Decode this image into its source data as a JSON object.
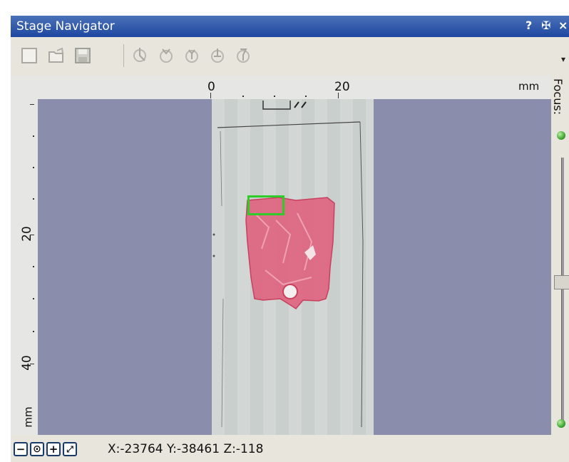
{
  "window": {
    "title": "Stage Navigator",
    "help_glyph": "?",
    "pin_glyph": "✠",
    "close_glyph": "×"
  },
  "toolbar": {
    "icons": [
      "new-icon",
      "open-icon",
      "save-icon",
      "tool-1-icon",
      "tool-2-icon",
      "tool-3-icon",
      "tool-4-icon",
      "tool-5-icon"
    ],
    "overflow_glyph": "▾"
  },
  "rulers": {
    "top_labels": [
      "0",
      "20",
      "mm"
    ],
    "left_labels": [
      "20",
      "40",
      "mm"
    ]
  },
  "focus": {
    "label": "Focus:",
    "level": 0.47
  },
  "status": {
    "coords": "X:-23764 Y:-38461 Z:-118",
    "buttons": [
      "−",
      "⊙",
      "+",
      "⤢"
    ]
  },
  "colors": {
    "title_bar": "#2a53a8",
    "viewport_bg": "#8b8dac",
    "roi_border": "#2dcc28",
    "tissue": "#e05a7a"
  }
}
